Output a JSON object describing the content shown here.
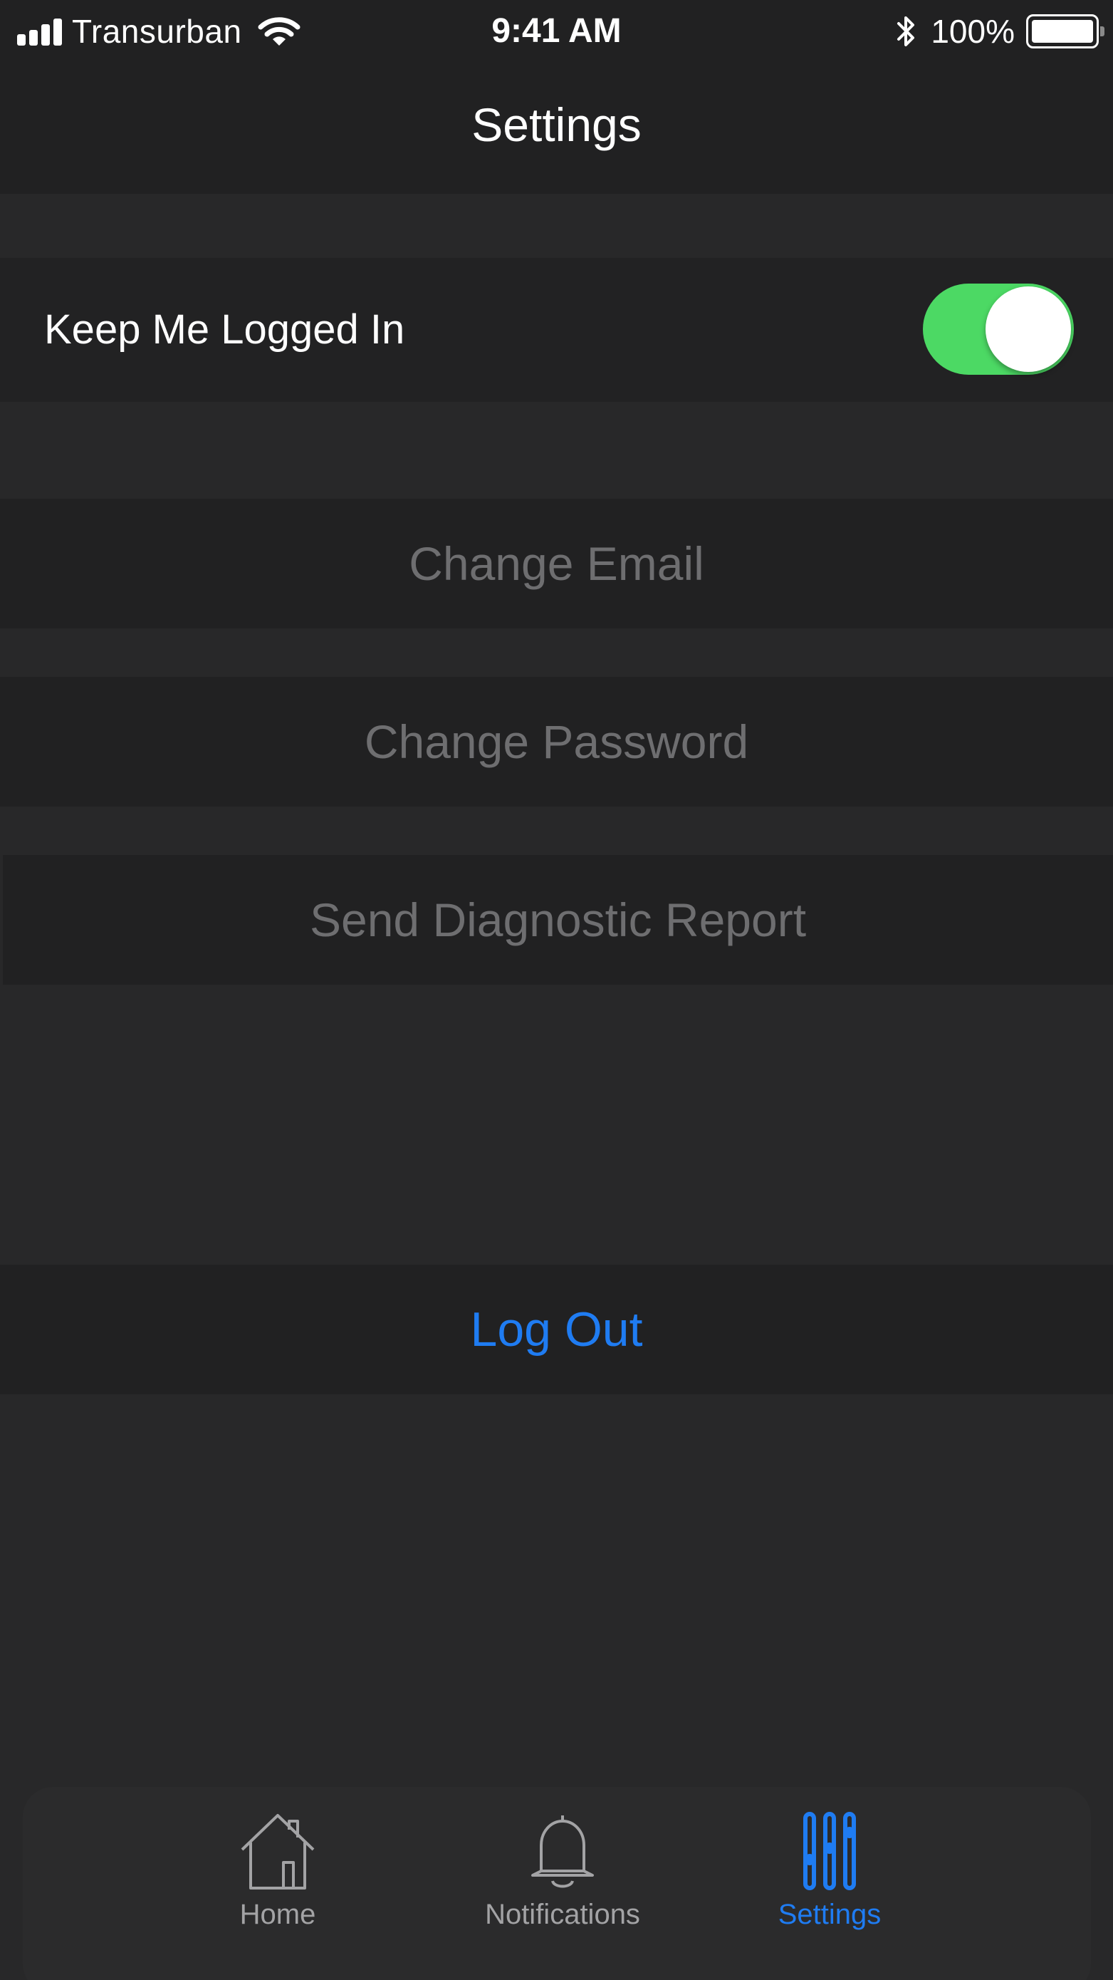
{
  "status_bar": {
    "carrier": "Transurban",
    "time": "9:41 AM",
    "battery_percent": "100%",
    "battery_level": 1.0,
    "icons": [
      "signal-bars-icon",
      "wifi-icon",
      "bluetooth-icon",
      "battery-icon"
    ]
  },
  "nav": {
    "title": "Settings"
  },
  "settings": {
    "keep_logged_in": {
      "label": "Keep Me Logged In",
      "on": true
    },
    "change_email": "Change Email",
    "change_password": "Change Password",
    "send_diagnostic": "Send Diagnostic Report",
    "log_out": "Log Out"
  },
  "tabs": [
    {
      "label": "Home",
      "icon": "house-icon",
      "active": false
    },
    {
      "label": "Notifications",
      "icon": "bell-icon",
      "active": false
    },
    {
      "label": "Settings",
      "icon": "sliders-icon",
      "active": true
    }
  ],
  "colors": {
    "background": "#282829",
    "bar": "#212122",
    "toggle_on": "#4cd964",
    "accent": "#1f7cf2",
    "disabled_text": "#6e6e70",
    "inactive_tab": "#a3a3a5"
  }
}
